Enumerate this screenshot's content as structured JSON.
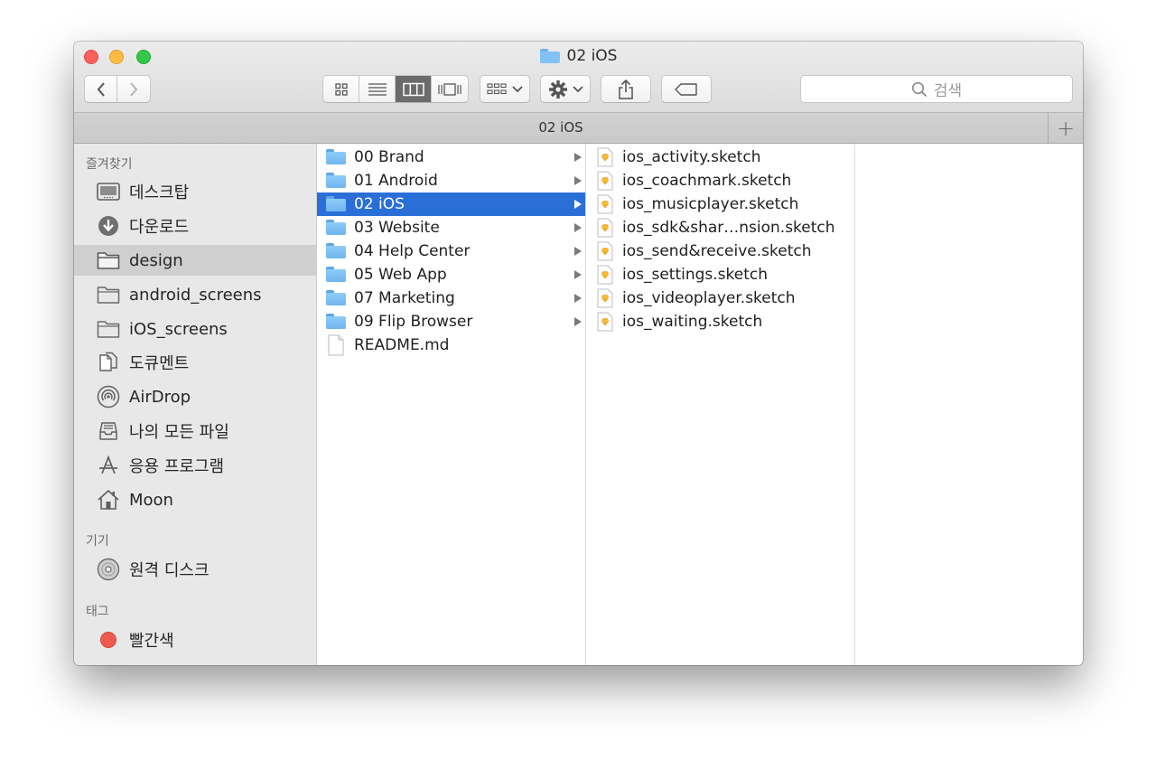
{
  "window": {
    "title": "02 iOS"
  },
  "toolbar": {
    "back_icon": "chevron-left-icon",
    "forward_icon": "chevron-right-icon",
    "view_modes": [
      "icon-view",
      "list-view",
      "column-view",
      "coverflow-view"
    ],
    "active_view": "column-view",
    "search_placeholder": "검색"
  },
  "tabbar": {
    "tab_label": "02 iOS",
    "new_tab": "+"
  },
  "sidebar": {
    "favorites_header": "즐겨찾기",
    "favorites": [
      {
        "label": "데스크탑",
        "icon": "desktop-icon"
      },
      {
        "label": "다운로드",
        "icon": "download-icon"
      },
      {
        "label": "design",
        "icon": "folder-icon",
        "selected": true
      },
      {
        "label": "android_screens",
        "icon": "folder-icon"
      },
      {
        "label": "iOS_screens",
        "icon": "folder-icon"
      },
      {
        "label": "도큐멘트",
        "icon": "documents-icon"
      },
      {
        "label": "AirDrop",
        "icon": "airdrop-icon"
      },
      {
        "label": "나의 모든 파일",
        "icon": "all-files-icon"
      },
      {
        "label": "응용 프로그램",
        "icon": "applications-icon"
      },
      {
        "label": "Moon",
        "icon": "home-icon"
      }
    ],
    "devices_header": "기기",
    "devices": [
      {
        "label": "원격 디스크",
        "icon": "disc-icon"
      }
    ],
    "tags_header": "태그",
    "tags": [
      {
        "label": "빨간색",
        "color": "#ec5b50"
      }
    ]
  },
  "column1": [
    {
      "name": "00 Brand",
      "type": "folder"
    },
    {
      "name": "01 Android",
      "type": "folder"
    },
    {
      "name": "02 iOS",
      "type": "folder",
      "selected": true
    },
    {
      "name": "03 Website",
      "type": "folder"
    },
    {
      "name": "04 Help Center",
      "type": "folder"
    },
    {
      "name": "05 Web App",
      "type": "folder"
    },
    {
      "name": "07 Marketing",
      "type": "folder"
    },
    {
      "name": "09 Flip Browser",
      "type": "folder"
    },
    {
      "name": "README.md",
      "type": "file"
    }
  ],
  "column2": [
    {
      "name": "ios_activity.sketch"
    },
    {
      "name": "ios_coachmark.sketch"
    },
    {
      "name": "ios_musicplayer.sketch"
    },
    {
      "name": "ios_sdk&shar…nsion.sketch"
    },
    {
      "name": "ios_send&receive.sketch"
    },
    {
      "name": "ios_settings.sketch"
    },
    {
      "name": "ios_videoplayer.sketch"
    },
    {
      "name": "ios_waiting.sketch"
    }
  ]
}
